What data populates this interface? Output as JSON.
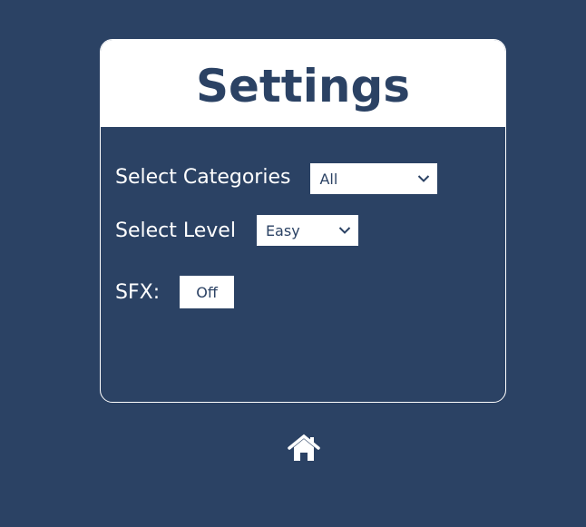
{
  "settings": {
    "title": "Settings",
    "category": {
      "label": "Select Categories",
      "selected": "All"
    },
    "level": {
      "label": "Select Level",
      "selected": "Easy"
    },
    "sfx": {
      "label": "SFX:",
      "value": "Off"
    }
  },
  "nav": {
    "home_icon": "home-icon"
  },
  "colors": {
    "background": "#2b4264",
    "card_header": "#ffffff",
    "text_light": "#ffffff",
    "text_dark": "#2b4264"
  }
}
